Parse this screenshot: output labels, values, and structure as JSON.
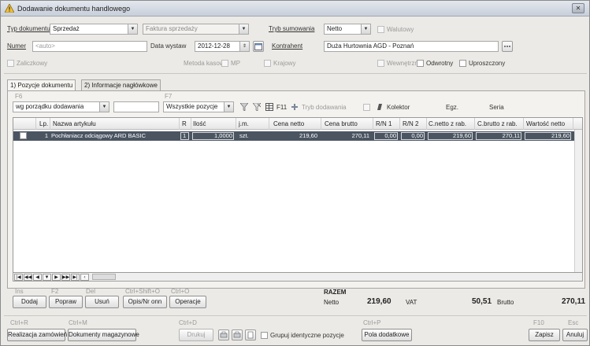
{
  "window": {
    "title": "Dodawanie dokumentu handlowego"
  },
  "header": {
    "typ_dokumentu_label": "Typ dokumentu",
    "typ_dokumentu_value": "Sprzedaż",
    "rodzaj_value": "Faktura sprzedaży",
    "tryb_sumowania_label": "Tryb sumowania",
    "tryb_sumowania_value": "Netto",
    "walutowy_label": "Walutowy",
    "numer_label": "Numer",
    "numer_placeholder": "<auto>",
    "data_wystaw_label": "Data wystaw",
    "data_wystaw_value": "2012-12-28",
    "kontrahent_label": "Kontrahent",
    "kontrahent_value": "Duża Hurtownia AGD - Poznań",
    "zaliczkowy_label": "Zaliczkowy",
    "metoda_kasowa_label": "Metoda kasowa",
    "mp_label": "MP",
    "krajowy_label": "Krajowy",
    "wewnetrzny_label": "Wewnętrzny",
    "odwrotny_label": "Odwrotny",
    "uproszczony_label": "Uproszczony"
  },
  "tabs": [
    {
      "label": "1) Pozycje dokumentu"
    },
    {
      "label": "2) Informacje nagłówkowe"
    }
  ],
  "toolbar": {
    "f6": "F6",
    "f7": "F7",
    "sort_value": "wg porządku dodawania",
    "filter_value": "Wszystkie pozycje",
    "f11": "F11",
    "tryb_dodawania": "Tryb dodawania",
    "kolektor": "Kolektor",
    "egz": "Egz.",
    "seria": "Seria"
  },
  "grid": {
    "columns": [
      "Lp.",
      "Nazwa artykułu",
      "R",
      "Ilość",
      "j.m.",
      "Cena netto",
      "Cena brutto",
      "R/N 1",
      "R/N 2",
      "C.netto z rab.",
      "C.brutto z rab.",
      "Wartość netto"
    ],
    "rows": [
      {
        "lp": "1",
        "nazwa": "Pochłaniacz odciągowy ARD BASIC",
        "r": "1",
        "ilosc": "1,0000",
        "jm": "szt.",
        "cena_netto": "219,60",
        "cena_brutto": "270,11",
        "rn1": "0,00",
        "rn2": "0,00",
        "c_netto_rab": "219,60",
        "c_brutto_rab": "270,11",
        "wartosc_netto": "219,60"
      }
    ]
  },
  "actions": {
    "ins": "Ins",
    "f2": "F2",
    "del": "Del",
    "ctrl_shift_o": "Ctrl+Shift+O",
    "ctrl_o": "Ctrl+O",
    "dodaj": "Dodaj",
    "popraw": "Popraw",
    "usun": "Usuń",
    "opis": "Opis/Nr onn",
    "operacje": "Operacje"
  },
  "summary": {
    "razem_label": "RAZEM",
    "netto_label": "Netto",
    "netto_value": "219,60",
    "vat_label": "VAT",
    "vat_value": "50,51",
    "brutto_label": "Brutto",
    "brutto_value": "270,11"
  },
  "footer": {
    "ctrl_r": "Ctrl+R",
    "ctrl_m": "Ctrl+M",
    "ctrl_d": "Ctrl+D",
    "ctrl_p": "Ctrl+P",
    "f10": "F10",
    "esc": "Esc",
    "realizacja": "Realizacja zamówień",
    "dokumenty": "Dokumenty magazynowe",
    "drukuj": "Drukuj",
    "grupuj": "Grupuj identyczne pozycje",
    "pola": "Pola dodatkowe",
    "zapisz": "Zapisz",
    "anuluj": "Anuluj"
  },
  "colors": {
    "selected_row": "#4b5562",
    "window_bg": "#eceae6",
    "titlebar": "#c8cfda"
  }
}
